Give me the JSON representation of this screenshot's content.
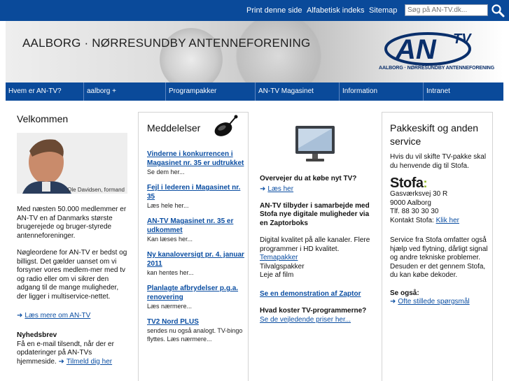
{
  "topbar": {
    "print": "Print denne side",
    "alpha_index": "Alfabetisk indeks",
    "sitemap": "Sitemap",
    "search_placeholder": "Søg på AN-TV.dk..."
  },
  "banner": {
    "title": "AALBORG · NØRRESUNDBY ANTENNEFORENING",
    "logo_text": "AN",
    "logo_tv": "TV",
    "logo_sub": "AALBORG · NØRRESUNDBY ANTENNEFORENING"
  },
  "nav": [
    "Hvem er AN-TV?",
    "aalborg +",
    "Programpakker",
    "AN-TV Magasinet",
    "Information",
    "Intranet"
  ],
  "welcome": {
    "heading": "Velkommen",
    "photo_caption": "Ole Davidsen, formand",
    "para1": "Med næsten 50.000 medlemmer er AN-TV en af Danmarks største brugerejede og bruger-styrede antenneforeninger.",
    "para2": "Nøgleordene for AN-TV er bedst og billigst. Det gælder uanset om vi forsyner vores medlem-mer med tv og radio eller om vi sikrer den adgang til de mange muligheder, der ligger i multiservice-nettet.",
    "more_link": "Læs mere om AN-TV",
    "newsletter_heading": "Nyhedsbrev",
    "newsletter_text": "Få en e-mail tilsendt, når der er opdateringer på AN-TVs hjemmeside.",
    "newsletter_link": "Tilmeld dig her"
  },
  "announcements": {
    "heading": "Meddelelser",
    "items": [
      {
        "title": "Vinderne i konkurrencen i Magasinet nr. 35 er udtrukket",
        "sub": "Se dem her..."
      },
      {
        "title": "Fejl i lederen i Magasinet nr. 35",
        "sub": "Læs hele her..."
      },
      {
        "title": "AN-TV Magasinet nr. 35 er udkommet",
        "sub": "Kan læses her..."
      },
      {
        "title": "Ny kanaloversigt pr. 4. januar 2011",
        "sub": "kan hentes her..."
      },
      {
        "title": "Planlagte afbrydelser p.g.a. renovering",
        "sub": "Læs nærmere..."
      },
      {
        "title": "TV2 Nord PLUS",
        "sub": "sendes nu også analogt. TV-bingo flyttes. Læs nærmere..."
      }
    ]
  },
  "tvcol": {
    "q1": "Overvejer du at købe nyt TV?",
    "q1_link": "Læs her",
    "zaptor_text": "AN-TV tilbyder i samarbejde med Stofa nye digitale muligheder via en Zaptorboks",
    "digital_text": "Digital kvalitet på alle kanaler. Flere programmer i HD kvalitet.",
    "temapakker": "Temapakker",
    "tilvalg": "Tilvalgspakker",
    "leje": "Leje af film",
    "demo_link": "Se en demonstration af Zaptor",
    "q2": "Hvad koster TV-programmerne?",
    "q2_link": "Se de vejledende priser her..."
  },
  "service": {
    "heading": "Pakkeskift og anden service",
    "intro": "Hvis du vil skifte TV-pakke skal du henvende dig til Stofa.",
    "stofa_logo": "Stofa",
    "addr1": "Gasværksvej 30 R",
    "addr2": "9000 Aalborg",
    "phone": "Tlf. 88 30 30 30",
    "contact": "Kontakt Stofa:",
    "contact_link": "Klik her",
    "service_text": "Service fra Stofa omfatter også hjælp ved flytning, dårligt signal og andre tekniske problemer. Desuden er det gennem Stofa, du kan købe dekoder.",
    "see_also": "Se også:",
    "faq_link": "Ofte stillede spørgsmål"
  },
  "colors": {
    "brand_blue": "#0a4a9a",
    "link_blue": "#0b4ea2"
  }
}
